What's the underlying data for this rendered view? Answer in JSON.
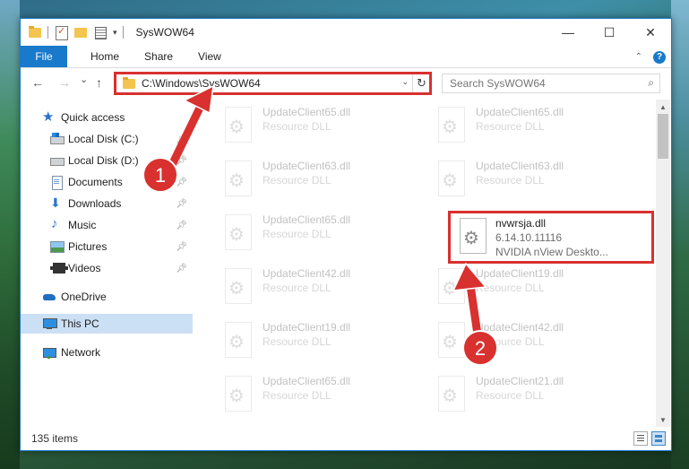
{
  "window": {
    "title": "SysWOW64",
    "controls": {
      "minimize": "—",
      "maximize": "☐",
      "close": "✕"
    }
  },
  "ribbon": {
    "tabs": [
      "File",
      "Home",
      "Share",
      "View"
    ],
    "help": "?"
  },
  "nav": {
    "back": "←",
    "forward": "→",
    "recent": "⌄",
    "up": "↑",
    "address": "C:\\Windows\\SysWOW64",
    "refresh": "↻",
    "search_placeholder": "Search SysWOW64"
  },
  "sidebar": {
    "items": [
      {
        "label": "Quick access",
        "icon": "star-icon",
        "pinned": false
      },
      {
        "label": "Local Disk (C:)",
        "icon": "drive-icon",
        "pinned": true
      },
      {
        "label": "Local Disk (D:)",
        "icon": "drive-icon",
        "pinned": true
      },
      {
        "label": "Documents",
        "icon": "documents-icon",
        "pinned": true
      },
      {
        "label": "Downloads",
        "icon": "downloads-icon",
        "pinned": true
      },
      {
        "label": "Music",
        "icon": "music-icon",
        "pinned": true
      },
      {
        "label": "Pictures",
        "icon": "pictures-icon",
        "pinned": true
      },
      {
        "label": "Videos",
        "icon": "videos-icon",
        "pinned": true
      },
      {
        "label": "OneDrive",
        "icon": "onedrive-icon",
        "pinned": false
      },
      {
        "label": "This PC",
        "icon": "this-pc-icon",
        "pinned": false,
        "selected": true
      },
      {
        "label": "Network",
        "icon": "network-icon",
        "pinned": false
      }
    ]
  },
  "files": {
    "left": [
      {
        "name": "UpdateClient65.dll",
        "type": "Resource DLL"
      },
      {
        "name": "UpdateClient63.dll",
        "type": "Resource DLL"
      },
      {
        "name": "UpdateClient65.dll",
        "type": "Resource DLL"
      },
      {
        "name": "UpdateClient42.dll",
        "type": "Resource DLL"
      },
      {
        "name": "UpdateClient19.dll",
        "type": "Resource DLL"
      },
      {
        "name": "UpdateClient65.dll",
        "type": "Resource DLL"
      }
    ],
    "right": [
      {
        "name": "UpdateClient65.dll",
        "type": "Resource DLL"
      },
      {
        "name": "UpdateClient63.dll",
        "type": "Resource DLL"
      },
      {
        "name": "nvwrsja.dll",
        "version": "6.14.10.11116",
        "description": "NVIDIA nView Deskto...",
        "highlighted": true
      },
      {
        "name": "UpdateClient19.dll",
        "type": "Resource DLL"
      },
      {
        "name": "UpdateClient42.dll",
        "type": "Resource DLL"
      },
      {
        "name": "UpdateClient21.dll",
        "type": "Resource DLL"
      }
    ]
  },
  "status": {
    "item_count": "135 items"
  },
  "annotations": {
    "step1": "1",
    "step2": "2",
    "color": "#d8312f"
  }
}
